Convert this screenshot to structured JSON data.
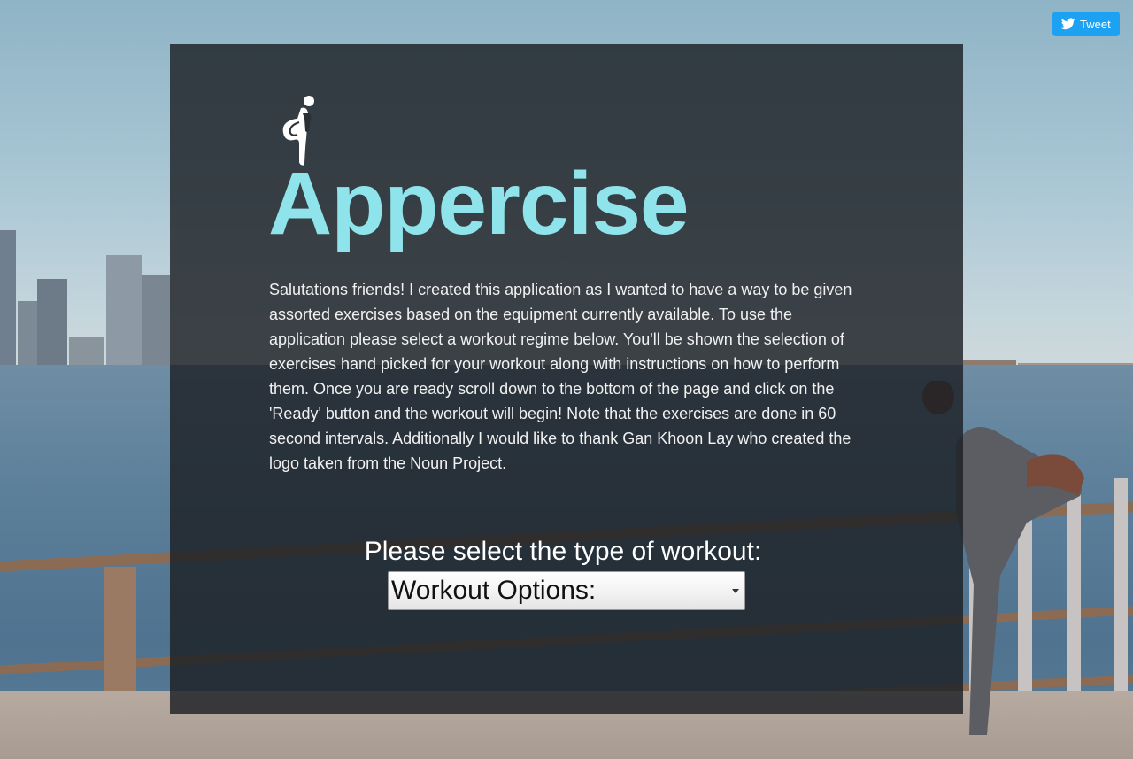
{
  "app": {
    "title": "Appercise",
    "logo_icon": "stretching-person-icon"
  },
  "intro_text": "Salutations friends! I created this application as I wanted to have a way to be given assorted exercises based on the equipment currently available. To use the application please select a workout regime below. You'll be shown the selection of exercises hand picked for your workout along with instructions on how to perform them. Once you are ready scroll down to the bottom of the page and click on the 'Ready' button and the workout will begin! Note that the exercises are done in 60 second intervals. Additionally I would like to thank Gan Khoon Lay who created the logo taken from the Noun Project.",
  "workout_select": {
    "label": "Please select the type of workout:",
    "selected": "Workout Options:"
  },
  "tweet_button": {
    "label": "Tweet",
    "icon": "twitter-bird-icon"
  },
  "colors": {
    "title": "#8fe3ea",
    "panel": "rgba(28,32,36,0.82)",
    "tweet": "#1da1f2"
  }
}
